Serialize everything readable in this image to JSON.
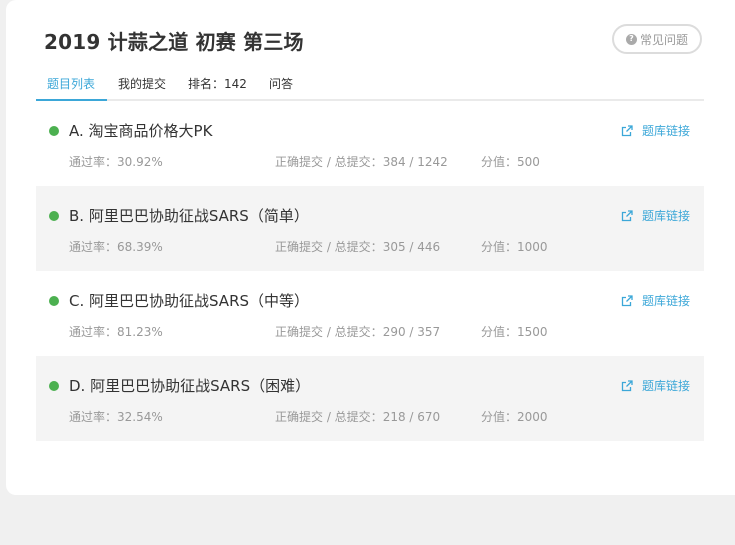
{
  "header": {
    "title": "2019 计蒜之道 初赛 第三场",
    "faq_label": "常见问题",
    "faq_icon": "question-circle-icon"
  },
  "tabs": [
    {
      "label": "题目列表",
      "active": true
    },
    {
      "label": "我的提交",
      "active": false
    },
    {
      "label": "排名：142",
      "active": false
    },
    {
      "label": "问答",
      "active": false
    }
  ],
  "labels": {
    "pass_rate": "通过率：",
    "submissions": "正确提交 / 总提交：",
    "score": "分值：",
    "link": "题库链接"
  },
  "colors": {
    "accent": "#3ba7d8",
    "solved_dot": "#4cb050",
    "muted_text": "#999999"
  },
  "problems": [
    {
      "title": "A. 淘宝商品价格大PK",
      "pass_rate": "30.92%",
      "submissions": "384 / 1242",
      "score": "500"
    },
    {
      "title": "B. 阿里巴巴协助征战SARS（简单）",
      "pass_rate": "68.39%",
      "submissions": "305 / 446",
      "score": "1000"
    },
    {
      "title": "C. 阿里巴巴协助征战SARS（中等）",
      "pass_rate": "81.23%",
      "submissions": "290 / 357",
      "score": "1500"
    },
    {
      "title": "D. 阿里巴巴协助征战SARS（困难）",
      "pass_rate": "32.54%",
      "submissions": "218 / 670",
      "score": "2000"
    }
  ]
}
